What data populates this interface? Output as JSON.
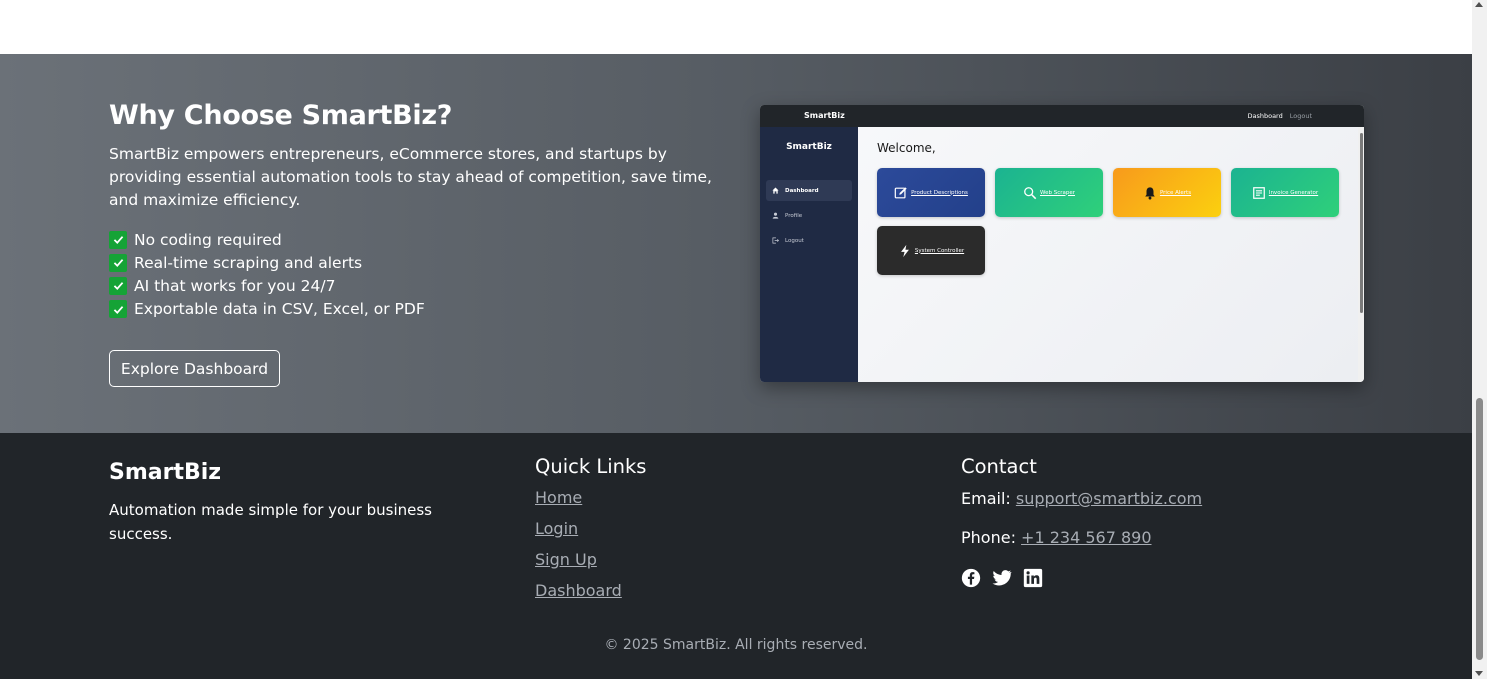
{
  "why": {
    "title": "Why Choose SmartBiz?",
    "description": "SmartBiz empowers entrepreneurs, eCommerce stores, and startups by providing essential automation tools to stay ahead of competition, save time, and maximize efficiency.",
    "features": [
      "No coding required",
      "Real-time scraping and alerts",
      "AI that works for you 24/7",
      "Exportable data in CSV, Excel, or PDF"
    ],
    "cta_label": "Explore Dashboard",
    "check_color": "#15a336"
  },
  "preview": {
    "brand": "SmartBiz",
    "nav_links": [
      "Dashboard",
      "Logout"
    ],
    "sidebar_brand": "SmartBiz",
    "sidebar_items": [
      "Dashboard",
      "Profile",
      "Logout"
    ],
    "welcome": "Welcome,",
    "cards": [
      {
        "label": "Product Descriptions",
        "icon": "edit-icon",
        "color": "#2c4a9a"
      },
      {
        "label": "Web Scraper",
        "icon": "search-icon",
        "color": "#1fbf86"
      },
      {
        "label": "Price Alerts",
        "icon": "bell-icon",
        "color": "#f7a41b"
      },
      {
        "label": "Invoice Generator",
        "icon": "invoice-icon",
        "color": "#1fbf86"
      },
      {
        "label": "System Controller",
        "icon": "bolt-icon",
        "color": "#2b2b2b"
      }
    ]
  },
  "footer": {
    "brand": "SmartBiz",
    "tagline": "Automation made simple for your business success.",
    "quick_links_title": "Quick Links",
    "quick_links": [
      "Home",
      "Login",
      "Sign Up",
      "Dashboard"
    ],
    "contact_title": "Contact",
    "email_label": "Email:",
    "email": "support@smartbiz.com",
    "phone_label": "Phone:",
    "phone": "+1 234 567 890",
    "social": [
      "facebook-icon",
      "twitter-icon",
      "linkedin-icon"
    ],
    "copyright": "© 2025 SmartBiz. All rights reserved."
  }
}
